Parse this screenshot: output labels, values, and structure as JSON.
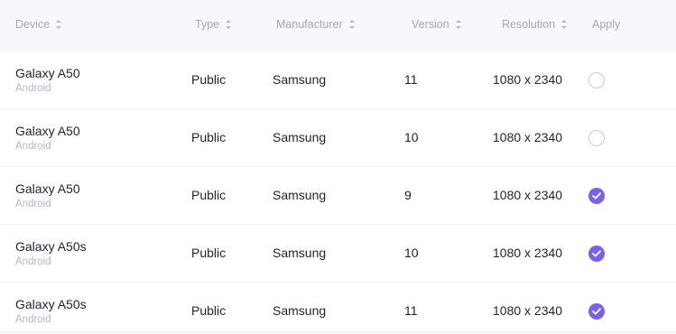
{
  "columns": {
    "device": "Device",
    "type": "Type",
    "manufacturer": "Manufacturer",
    "version": "Version",
    "resolution": "Resolution",
    "apply": "Apply"
  },
  "colors": {
    "accent": "#7b61e8",
    "muted": "#a3a7b7"
  },
  "rows": [
    {
      "device": "Galaxy A50",
      "os": "Android",
      "type": "Public",
      "manufacturer": "Samsung",
      "version": "11",
      "resolution": "1080 x 2340",
      "applied": false
    },
    {
      "device": "Galaxy A50",
      "os": "Android",
      "type": "Public",
      "manufacturer": "Samsung",
      "version": "10",
      "resolution": "1080 x 2340",
      "applied": false
    },
    {
      "device": "Galaxy A50",
      "os": "Android",
      "type": "Public",
      "manufacturer": "Samsung",
      "version": "9",
      "resolution": "1080 x 2340",
      "applied": true
    },
    {
      "device": "Galaxy A50s",
      "os": "Android",
      "type": "Public",
      "manufacturer": "Samsung",
      "version": "10",
      "resolution": "1080 x 2340",
      "applied": true
    },
    {
      "device": "Galaxy A50s",
      "os": "Android",
      "type": "Public",
      "manufacturer": "Samsung",
      "version": "11",
      "resolution": "1080 x 2340",
      "applied": true
    }
  ]
}
